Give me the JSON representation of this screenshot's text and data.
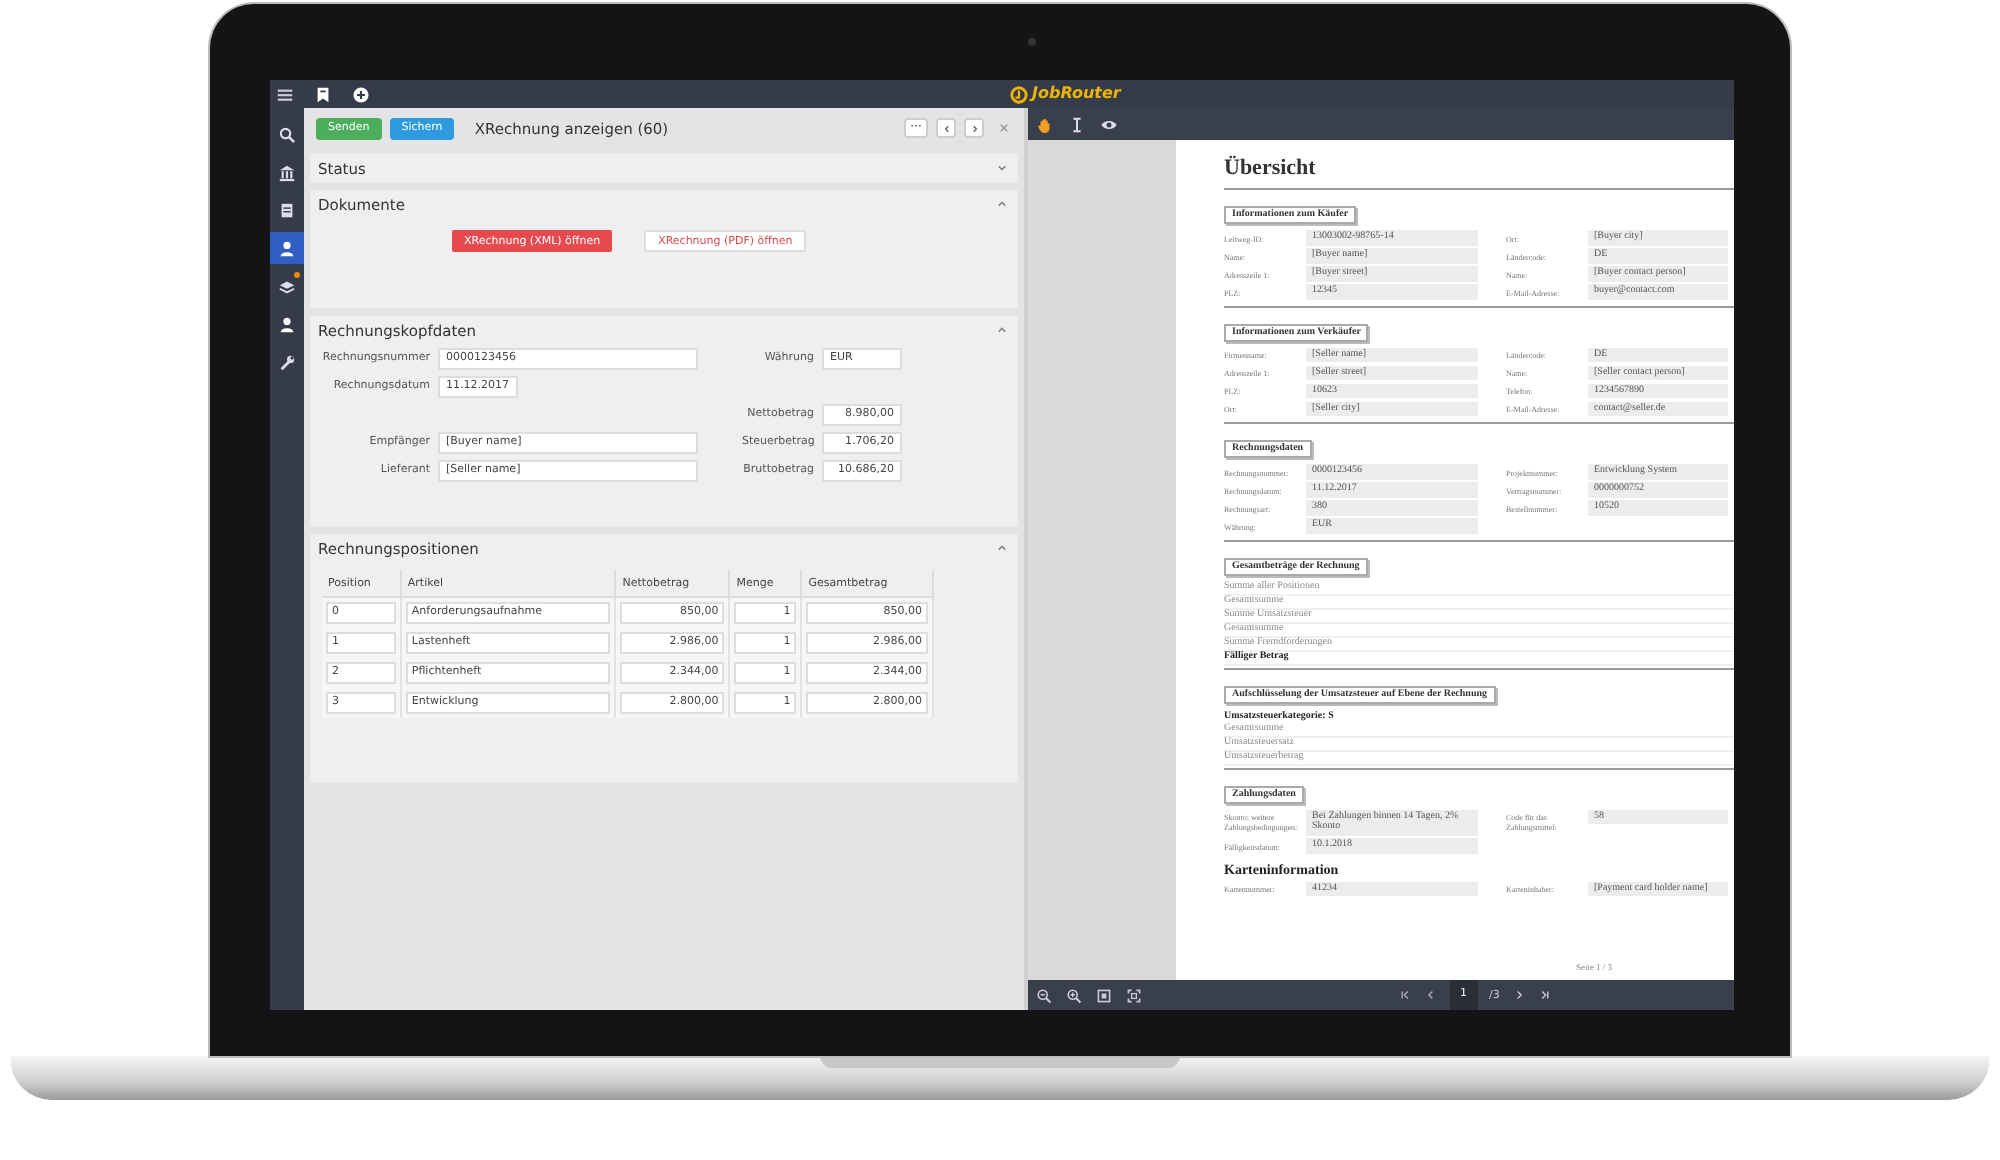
{
  "top_bar": {
    "brand": "JobRouter"
  },
  "sidebar": {
    "items": [
      {
        "kind": "search",
        "selected": false,
        "badge": false
      },
      {
        "kind": "bank",
        "selected": false,
        "badge": false
      },
      {
        "kind": "document",
        "selected": false,
        "badge": false
      },
      {
        "kind": "user",
        "selected": true,
        "badge": false
      },
      {
        "kind": "layers",
        "selected": false,
        "badge": true
      },
      {
        "kind": "user",
        "selected": false,
        "badge": false
      },
      {
        "kind": "wrench",
        "selected": false,
        "badge": false
      }
    ]
  },
  "form": {
    "actions": [
      {
        "label": "Senden",
        "kind": "send"
      },
      {
        "label": "Sichern",
        "kind": "save"
      }
    ],
    "title": "XRechnung anzeigen (60)",
    "more_button": "···",
    "status_section": {
      "title": "Status",
      "expanded": false
    },
    "documents_section": {
      "title": "Dokumente",
      "expanded": true,
      "buttons": [
        {
          "label": "XRechnung (XML) öffnen",
          "kind": "danger"
        },
        {
          "label": "XRechnung (PDF) öffnen",
          "kind": "outline"
        }
      ]
    },
    "header_section": {
      "title": "Rechnungskopfdaten",
      "expanded": true,
      "rows": [
        {
          "left": {
            "label": "Rechnungsnummer",
            "value": "0000123456",
            "kind": "wide"
          },
          "right": {
            "label": "Währung",
            "value": "EUR",
            "kind": "text"
          }
        },
        {
          "left": {
            "label": "Rechnungsdatum",
            "value": "11.12.2017",
            "kind": "short"
          }
        },
        {
          "right": {
            "label": "Nettobetrag",
            "value": "8.980,00",
            "kind": "amount"
          }
        },
        {
          "left": {
            "label": "Empfänger",
            "value": "[Buyer name]",
            "kind": "wide"
          },
          "right": {
            "label": "Steuerbetrag",
            "value": "1.706,20",
            "kind": "amount"
          }
        },
        {
          "left": {
            "label": "Lieferant",
            "value": "[Seller name]",
            "kind": "wide"
          },
          "right": {
            "label": "Bruttobetrag",
            "value": "10.686,20",
            "kind": "amount"
          }
        }
      ]
    },
    "positions_section": {
      "title": "Rechnungspositionen",
      "expanded": true,
      "columns": [
        {
          "label": "Position",
          "kind": "text"
        },
        {
          "label": "Artikel",
          "kind": "text"
        },
        {
          "label": "Nettobetrag",
          "kind": "amount"
        },
        {
          "label": "Menge",
          "kind": "amount"
        },
        {
          "label": "Gesamtbetrag",
          "kind": "amount"
        }
      ],
      "rows": [
        [
          "0",
          "Anforderungsaufnahme",
          "850,00",
          "1",
          "850,00"
        ],
        [
          "1",
          "Lastenheft",
          "2.986,00",
          "1",
          "2.986,00"
        ],
        [
          "2",
          "Pflichtenheft",
          "2.344,00",
          "1",
          "2.344,00"
        ],
        [
          "3",
          "Entwicklung",
          "2.800,00",
          "1",
          "2.800,00"
        ]
      ]
    }
  },
  "viewer": {
    "tools": [
      {
        "kind": "hand",
        "selected": true
      },
      {
        "kind": "text",
        "selected": false
      },
      {
        "kind": "eye",
        "selected": false
      }
    ],
    "page": {
      "title": "Übersicht",
      "sections": [
        {
          "title": "Informationen zum Käufer",
          "kind": "fields",
          "rows": [
            [
              {
                "label": "Leitweg-ID:",
                "value": "13003002-98765-14"
              },
              {
                "label": "Ort:",
                "value": "[Buyer city]"
              }
            ],
            [
              {
                "label": "Name:",
                "value": "[Buyer name]"
              },
              {
                "label": "Ländercode:",
                "value": "DE"
              }
            ],
            [
              {
                "label": "Adresszeile 1:",
                "value": "[Buyer street]"
              },
              {
                "label": "Name:",
                "value": "[Buyer contact person]"
              }
            ],
            [
              {
                "label": "PLZ:",
                "value": "12345"
              },
              {
                "label": "E-Mail-Adresse:",
                "value": "buyer@contact.com"
              }
            ]
          ]
        },
        {
          "title": "Informationen zum Verkäufer",
          "kind": "fields",
          "rows": [
            [
              {
                "label": "Firmenname:",
                "value": "[Seller name]"
              },
              {
                "label": "Ländercode:",
                "value": "DE"
              }
            ],
            [
              {
                "label": "Adresszeile 1:",
                "value": "[Seller street]"
              },
              {
                "label": "Name:",
                "value": "[Seller contact person]"
              }
            ],
            [
              {
                "label": "PLZ:",
                "value": "10623"
              },
              {
                "label": "Telefon:",
                "value": "1234567890"
              }
            ],
            [
              {
                "label": "Ort:",
                "value": "[Seller city]"
              },
              {
                "label": "E-Mail-Adresse:",
                "value": "contact@seller.de"
              }
            ]
          ]
        },
        {
          "title": "Rechnungsdaten",
          "kind": "fields",
          "rows": [
            [
              {
                "label": "Rechnungsnummer:",
                "value": "0000123456"
              },
              {
                "label": "Projektnummer:",
                "value": "Entwicklung System"
              }
            ],
            [
              {
                "label": "Rechnungsdatum:",
                "value": "11.12.2017"
              },
              {
                "label": "Vertragsnummer:",
                "value": "0000000752"
              }
            ],
            [
              {
                "label": "Rechnungsart:",
                "value": "380"
              },
              {
                "label": "Bestellnummer:",
                "value": "10520"
              }
            ],
            [
              {
                "label": "Währung:",
                "value": "EUR"
              }
            ]
          ]
        },
        {
          "title": "Gesamtbeträge der Rechnung",
          "kind": "lines",
          "lines": [
            {
              "label": "Summe aller Positionen",
              "emphasized": false
            },
            {
              "label": "Gesamtsumme",
              "emphasized": false
            },
            {
              "label": "Summe Umsatzsteuer",
              "emphasized": false
            },
            {
              "label": "Gesamtsumme",
              "emphasized": false
            },
            {
              "label": "Summe Fremdforderungen",
              "emphasized": false
            },
            {
              "label": "Fälliger Betrag",
              "emphasized": true
            }
          ]
        },
        {
          "title": "Aufschlüsselung der Umsatzsteuer auf Ebene der Rechnung",
          "kind": "lines",
          "subheading": "Umsatzsteuerkategorie: S",
          "lines": [
            {
              "label": "Gesamtsumme",
              "emphasized": false
            },
            {
              "label": "Umsatzsteuersatz",
              "emphasized": false
            },
            {
              "label": "Umsatzsteuerbetrag",
              "emphasized": false
            }
          ]
        },
        {
          "title": "Zahlungsdaten",
          "kind": "fields",
          "rows": [
            [
              {
                "label": "Skonto; weitere Zahlungsbedingungen:",
                "value": "Bei Zahlungen binnen 14 Tagen, 2% Skonto"
              },
              {
                "label": "Code für das Zahlungsmittel:",
                "value": "58"
              }
            ],
            [
              {
                "label": "Fälligkeitsdatum:",
                "value": "10.1.2018"
              }
            ]
          ]
        },
        {
          "title": "Karteninformation",
          "kind": "subfields",
          "rows": [
            [
              {
                "label": "Kartennummer:",
                "value": "41234"
              },
              {
                "label": "Karteninhaber:",
                "value": "[Payment card holder name]"
              }
            ]
          ]
        }
      ],
      "footer": "Seite 1 / 3"
    },
    "pager": {
      "current": "1",
      "total": "/3"
    }
  }
}
